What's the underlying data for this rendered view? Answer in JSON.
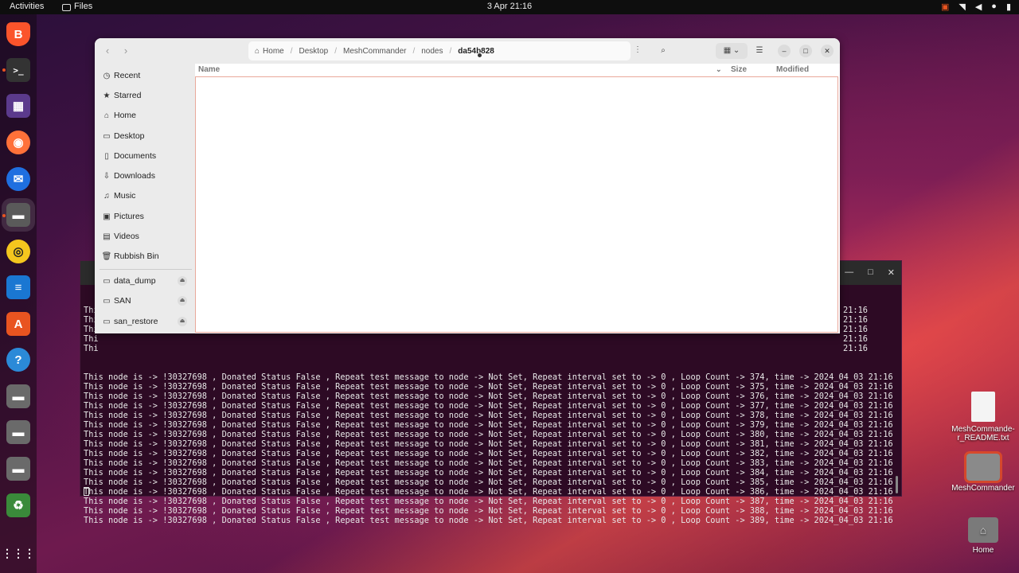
{
  "topbar": {
    "activities": "Activities",
    "app": "Files",
    "clock": "3 Apr  21:16"
  },
  "dock": {
    "items": [
      "brave-browser-icon",
      "terminal-icon",
      "video-editor-icon",
      "firefox-icon",
      "thunderbird-icon",
      "files-icon",
      "rhythmbox-icon",
      "writer-icon",
      "app-center-icon",
      "help-icon",
      "folder-icon",
      "folder-icon",
      "folder-icon",
      "trash-icon",
      "show-apps-icon"
    ]
  },
  "files": {
    "path": [
      "Home",
      "Desktop",
      "MeshCommander",
      "nodes",
      "da54b828"
    ],
    "sidebar": [
      "Recent",
      "Starred",
      "Home",
      "Desktop",
      "Documents",
      "Downloads",
      "Music",
      "Pictures",
      "Videos",
      "Rubbish Bin"
    ],
    "mounts": [
      "data_dump",
      "SAN",
      "san_restore"
    ],
    "columns": {
      "name": "Name",
      "size": "Size",
      "modified": "Modified"
    }
  },
  "terminal": {
    "partial_lines": [
      "Thi",
      "Thi",
      "Thi",
      "Thi",
      "Thi"
    ],
    "right_times": [
      "21:16",
      "21:16",
      "21:16",
      "21:16",
      "21:16"
    ],
    "lines": [
      "This node is -> !30327698 , Donated Status False , Repeat test message to node -> Not Set, Repeat interval set to -> 0 , Loop Count -> 374, time -> 2024_04_03 21:16",
      "This node is -> !30327698 , Donated Status False , Repeat test message to node -> Not Set, Repeat interval set to -> 0 , Loop Count -> 375, time -> 2024_04_03 21:16",
      "This node is -> !30327698 , Donated Status False , Repeat test message to node -> Not Set, Repeat interval set to -> 0 , Loop Count -> 376, time -> 2024_04_03 21:16",
      "This node is -> !30327698 , Donated Status False , Repeat test message to node -> Not Set, Repeat interval set to -> 0 , Loop Count -> 377, time -> 2024_04_03 21:16",
      "This node is -> !30327698 , Donated Status False , Repeat test message to node -> Not Set, Repeat interval set to -> 0 , Loop Count -> 378, time -> 2024_04_03 21:16",
      "This node is -> !30327698 , Donated Status False , Repeat test message to node -> Not Set, Repeat interval set to -> 0 , Loop Count -> 379, time -> 2024_04_03 21:16",
      "This node is -> !30327698 , Donated Status False , Repeat test message to node -> Not Set, Repeat interval set to -> 0 , Loop Count -> 380, time -> 2024_04_03 21:16",
      "This node is -> !30327698 , Donated Status False , Repeat test message to node -> Not Set, Repeat interval set to -> 0 , Loop Count -> 381, time -> 2024_04_03 21:16",
      "This node is -> !30327698 , Donated Status False , Repeat test message to node -> Not Set, Repeat interval set to -> 0 , Loop Count -> 382, time -> 2024_04_03 21:16",
      "This node is -> !30327698 , Donated Status False , Repeat test message to node -> Not Set, Repeat interval set to -> 0 , Loop Count -> 383, time -> 2024_04_03 21:16",
      "This node is -> !30327698 , Donated Status False , Repeat test message to node -> Not Set, Repeat interval set to -> 0 , Loop Count -> 384, time -> 2024_04_03 21:16",
      "This node is -> !30327698 , Donated Status False , Repeat test message to node -> Not Set, Repeat interval set to -> 0 , Loop Count -> 385, time -> 2024_04_03 21:16",
      "This node is -> !30327698 , Donated Status False , Repeat test message to node -> Not Set, Repeat interval set to -> 0 , Loop Count -> 386, time -> 2024_04_03 21:16",
      "This node is -> !30327698 , Donated Status False , Repeat test message to node -> Not Set, Repeat interval set to -> 0 , Loop Count -> 387, time -> 2024_04_03 21:16",
      "This node is -> !30327698 , Donated Status False , Repeat test message to node -> Not Set, Repeat interval set to -> 0 , Loop Count -> 388, time -> 2024_04_03 21:16",
      "This node is -> !30327698 , Donated Status False , Repeat test message to node -> Not Set, Repeat interval set to -> 0 , Loop Count -> 389, time -> 2024_04_03 21:16"
    ]
  },
  "desktop": {
    "readme": "MeshCommande-r_README.txt",
    "folder": "MeshCommander",
    "home": "Home"
  },
  "colors": {
    "accent": "#e95420",
    "terminal_bg": "#2d0a24"
  }
}
